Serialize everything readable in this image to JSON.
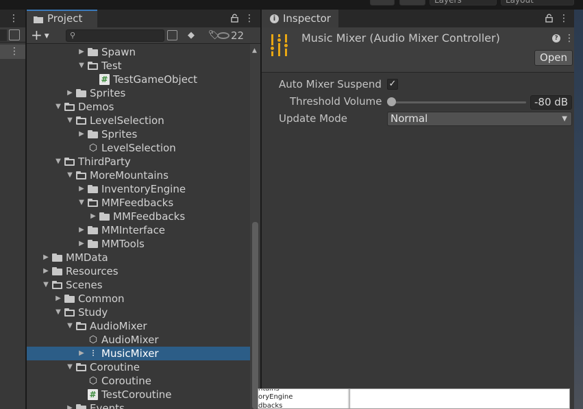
{
  "toolbar": {
    "layers_label": "Layers",
    "layout_label": "Layout"
  },
  "project": {
    "tab_label": "Project",
    "hidden_count": "22",
    "tree": [
      {
        "label": "Spawn",
        "depth": 4,
        "type": "folder",
        "expanded": false
      },
      {
        "label": "Test",
        "depth": 4,
        "type": "folder",
        "expanded": true
      },
      {
        "label": "TestGameObject",
        "depth": 5,
        "type": "script"
      },
      {
        "label": "Sprites",
        "depth": 3,
        "type": "folder",
        "expanded": false
      },
      {
        "label": "Demos",
        "depth": 2,
        "type": "folder",
        "expanded": true
      },
      {
        "label": "LevelSelection",
        "depth": 3,
        "type": "folder",
        "expanded": true
      },
      {
        "label": "Sprites",
        "depth": 4,
        "type": "folder",
        "expanded": false
      },
      {
        "label": "LevelSelection",
        "depth": 4,
        "type": "prefab"
      },
      {
        "label": "ThirdParty",
        "depth": 2,
        "type": "folder",
        "expanded": true
      },
      {
        "label": "MoreMountains",
        "depth": 3,
        "type": "folder",
        "expanded": true
      },
      {
        "label": "InventoryEngine",
        "depth": 4,
        "type": "folder",
        "expanded": false
      },
      {
        "label": "MMFeedbacks",
        "depth": 4,
        "type": "folder",
        "expanded": true
      },
      {
        "label": "MMFeedbacks",
        "depth": 5,
        "type": "folder",
        "expanded": false
      },
      {
        "label": "MMInterface",
        "depth": 4,
        "type": "folder",
        "expanded": false
      },
      {
        "label": "MMTools",
        "depth": 4,
        "type": "folder",
        "expanded": false
      },
      {
        "label": "MMData",
        "depth": 1,
        "type": "folder",
        "expanded": false
      },
      {
        "label": "Resources",
        "depth": 1,
        "type": "folder",
        "expanded": false
      },
      {
        "label": "Scenes",
        "depth": 1,
        "type": "folder",
        "expanded": true
      },
      {
        "label": "Common",
        "depth": 2,
        "type": "folder",
        "expanded": false
      },
      {
        "label": "Study",
        "depth": 2,
        "type": "folder",
        "expanded": true
      },
      {
        "label": "AudioMixer",
        "depth": 3,
        "type": "folder",
        "expanded": true
      },
      {
        "label": "AudioMixer",
        "depth": 4,
        "type": "prefab"
      },
      {
        "label": "MusicMixer",
        "depth": 4,
        "type": "mixer",
        "collapsed_child": true,
        "selected": true
      },
      {
        "label": "Coroutine",
        "depth": 3,
        "type": "folder",
        "expanded": true
      },
      {
        "label": "Coroutine",
        "depth": 4,
        "type": "prefab"
      },
      {
        "label": "TestCoroutine",
        "depth": 4,
        "type": "script"
      },
      {
        "label": "Events",
        "depth": 3,
        "type": "folder",
        "expanded": false
      }
    ]
  },
  "inspector": {
    "tab_label": "Inspector",
    "title": "Music Mixer (Audio Mixer Controller)",
    "open_label": "Open",
    "auto_suspend_label": "Auto Mixer Suspend",
    "auto_suspend_checked": true,
    "threshold_label": "Threshold Volume",
    "threshold_value": "-80 dB",
    "threshold_fraction": 0,
    "update_mode_label": "Update Mode",
    "update_mode_value": "Normal"
  },
  "mini_overlay": {
    "lines": [
      "ntains",
      "oryEngine",
      "dbacks"
    ]
  },
  "colors": {
    "accent_tab": "#3a79bb",
    "selection": "#2c5d87",
    "mixer_icon": "#e9a713"
  }
}
